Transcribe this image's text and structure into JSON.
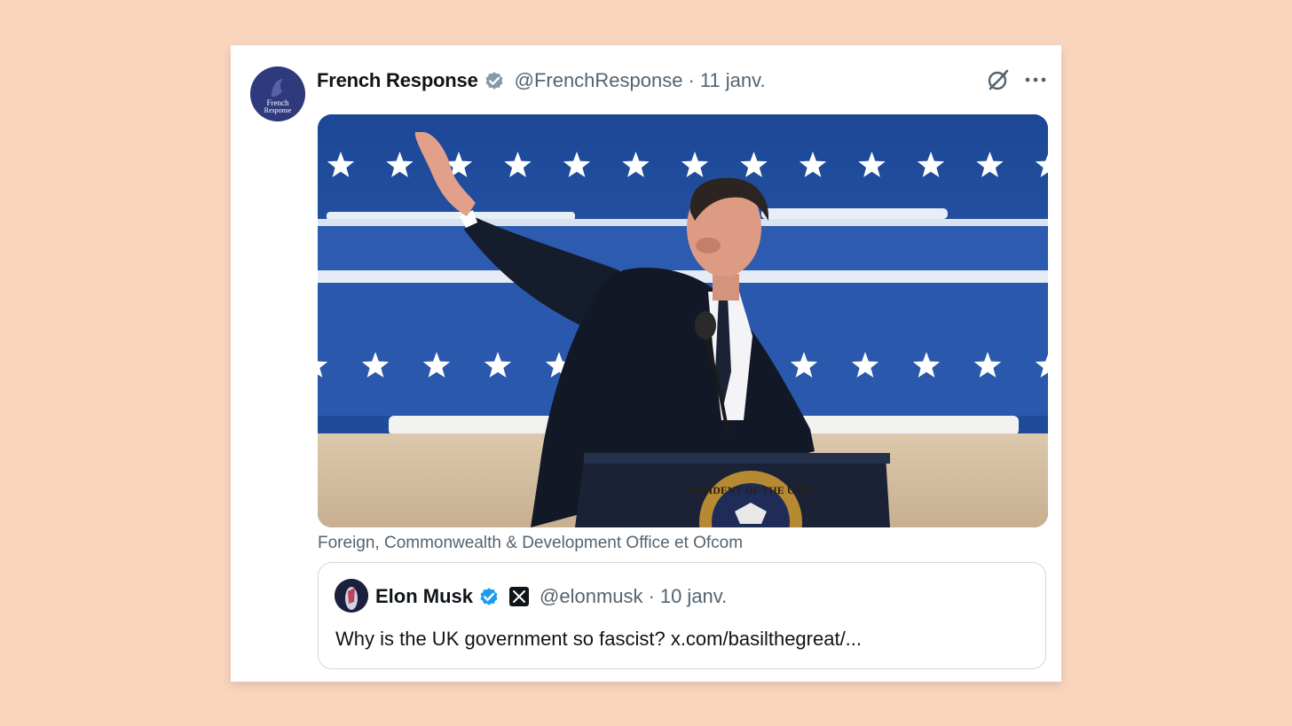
{
  "post": {
    "author_name": "French Response",
    "handle": "@FrenchResponse",
    "separator": "·",
    "date": "11 janv.",
    "avatar_text_line1": "French",
    "avatar_text_line2": "Response",
    "media_caption": "Foreign, Commonwealth & Development Office et Ofcom",
    "verified_badge_color": "#829aab",
    "icons": [
      "grok-icon",
      "more-icon"
    ]
  },
  "quoted_post": {
    "author_name": "Elon Musk",
    "handle": "@elonmusk",
    "separator": "·",
    "date": "10 janv.",
    "text": "Why is the UK government so fascist? x.com/basilthegreat/...",
    "verified_badge_color": "#1d9bf0",
    "affiliate_badge": "x-logo-icon"
  },
  "media": {
    "seal_text": "RESIDENT OF THE UNIT"
  },
  "colors": {
    "page_background": "#f9d5bd",
    "card_background": "#ffffff",
    "secondary_text": "#536471",
    "primary_text": "#0f1419"
  }
}
